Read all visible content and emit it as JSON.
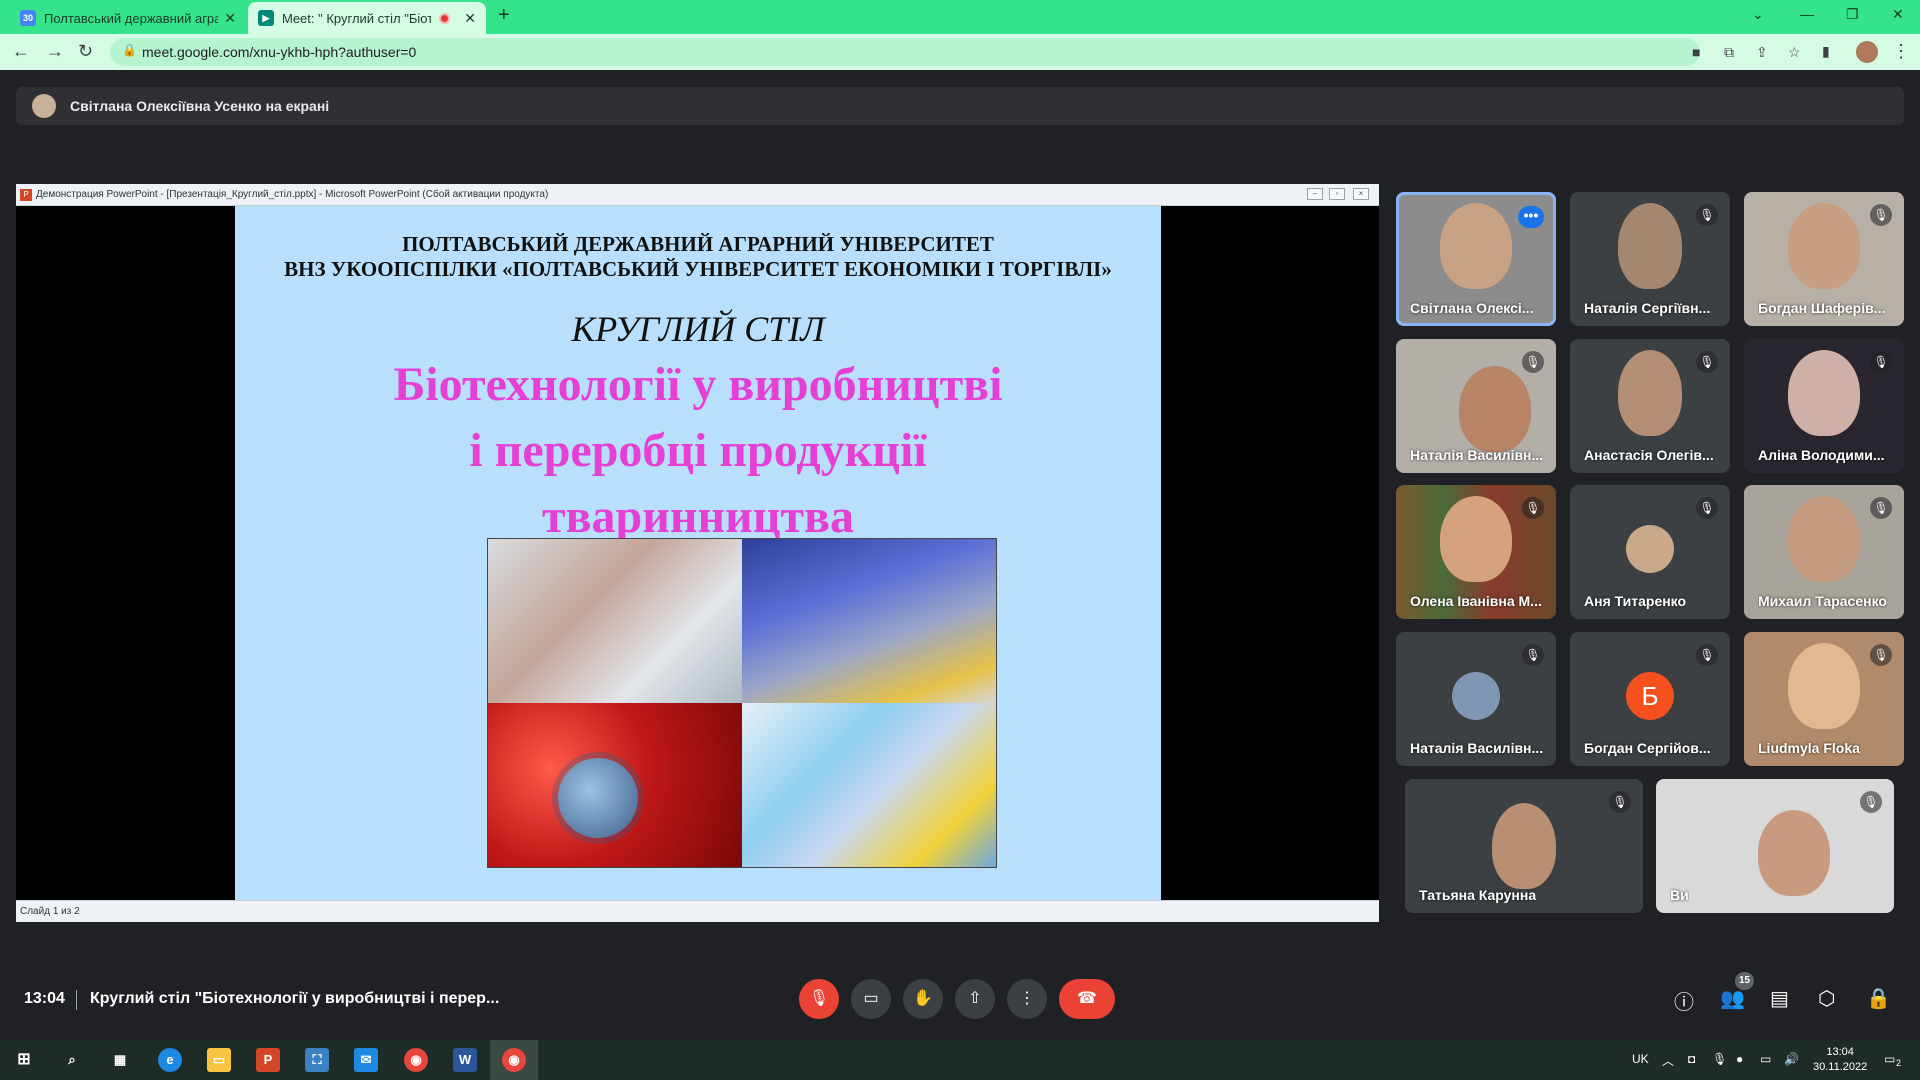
{
  "browser": {
    "tabs": [
      {
        "title": "Полтавський державний аграрний",
        "favicon": "calendar-icon"
      },
      {
        "title": "Meet: \" Круглий стіл \"Біотех",
        "favicon": "meet-icon",
        "recording": true
      }
    ],
    "url": "meet.google.com/xnu-ykhb-hph?authuser=0"
  },
  "banner": {
    "text": "Світлана Олексіївна Усенко на екрані"
  },
  "presentation": {
    "window_title": "Демонстрация PowerPoint - [Презентація_Круглий_стіл.pptx] - Microsoft PowerPoint (Сбой активации продукта)",
    "status": "Слайд 1 из 2",
    "slide": {
      "university1": "ПОЛТАВСЬКИЙ ДЕРЖАВНИЙ АГРАРНИЙ УНІВЕРСИТЕТ",
      "university2": "ВНЗ УКООПСПІЛКИ «ПОЛТАВСЬКИЙ УНІВЕРСИТЕТ ЕКОНОМІКИ І ТОРГІВЛІ»",
      "round_table": "КРУГЛИЙ СТІЛ",
      "main_title_1": "Біотехнології у виробництві",
      "main_title_2": "і переробці продукції",
      "main_title_3": "тваринництва"
    }
  },
  "participants": [
    {
      "name": "Світлана Олексі...",
      "state": "speaking"
    },
    {
      "name": "Наталія Сергіївн...",
      "state": "muted"
    },
    {
      "name": "Богдан Шаферів...",
      "state": "muted"
    },
    {
      "name": "Наталія Василівн...",
      "state": "muted"
    },
    {
      "name": "Анастасія Олегів...",
      "state": "muted"
    },
    {
      "name": "Аліна Володими...",
      "state": "muted"
    },
    {
      "name": "Олена Іванівна М...",
      "state": "muted"
    },
    {
      "name": "Аня Титаренко",
      "state": "muted"
    },
    {
      "name": "Михаил Тарасенко",
      "state": "muted"
    },
    {
      "name": "Наталія Василівн...",
      "state": "muted"
    },
    {
      "name": "Богдан Сергійов...",
      "state": "muted",
      "initial": "Б"
    },
    {
      "name": "Liudmyla Floka",
      "state": "muted"
    },
    {
      "name": "Татьяна Карунна",
      "state": "muted"
    },
    {
      "name": "Ви",
      "state": "muted"
    }
  ],
  "bottom_bar": {
    "time": "13:04",
    "meeting_title": "Круглий стіл \"Біотехнології у виробництві і перер...",
    "participant_count": "15"
  },
  "taskbar": {
    "lang": "UK",
    "time": "13:04",
    "date": "30.11.2022",
    "notifications": "2"
  },
  "colors": {
    "chrome_tab_strip": "#35e48a",
    "meet_background": "#202124",
    "slide_background": "#b8dffb",
    "slide_title": "#e53fd6",
    "hangup": "#ea4335",
    "speaking_border": "#8ab4f8"
  }
}
